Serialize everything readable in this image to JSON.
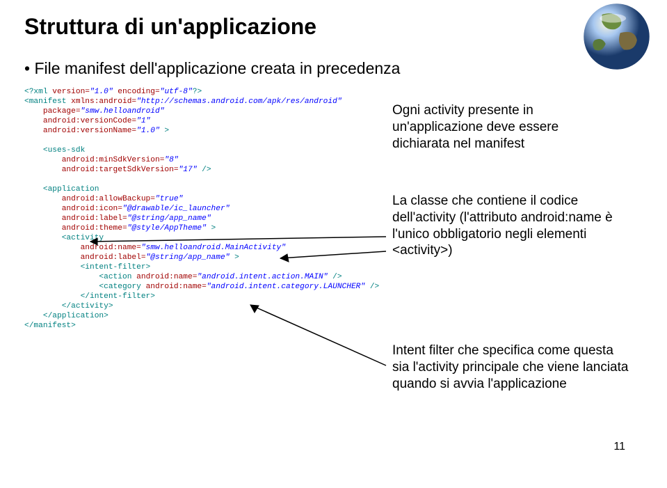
{
  "title": "Struttura di un'applicazione",
  "bullet1": "File manifest dell'applicazione creata in precedenza",
  "annotations": {
    "a1": "Ogni activity presente in un'applicazione deve essere dichiarata nel manifest",
    "a2": "La classe che contiene il codice dell'activity (l'attributo android:name è l'unico obbligatorio negli elementi <activity>)",
    "a3": "Intent filter che specifica come questa sia l'activity principale che viene lanciata quando si avvia l'applicazione"
  },
  "code": {
    "l1a": "<?xml ",
    "l1b": "version=",
    "l1c": "\"1.0\"",
    "l1d": " encoding=",
    "l1e": "\"utf-8\"",
    "l1f": "?>",
    "l2a": "<manifest ",
    "l2b": "xmlns:android=",
    "l2c": "\"http://schemas.android.com/apk/res/android\"",
    "l3a": "    package=",
    "l3b": "\"smw.helloandroid\"",
    "l4a": "    android:versionCode=",
    "l4b": "\"1\"",
    "l5a": "    android:versionName=",
    "l5b": "\"1.0\"",
    "l5c": " >",
    "l6": "",
    "l7a": "    <uses-sdk",
    "l8a": "        android:minSdkVersion=",
    "l8b": "\"8\"",
    "l9a": "        android:targetSdkVersion=",
    "l9b": "\"17\"",
    "l9c": " />",
    "l10": "",
    "l11a": "    <application",
    "l12a": "        android:allowBackup=",
    "l12b": "\"true\"",
    "l13a": "        android:icon=",
    "l13b": "\"@drawable/ic_launcher\"",
    "l14a": "        android:label=",
    "l14b": "\"@string/app_name\"",
    "l15a": "        android:theme=",
    "l15b": "\"@style/AppTheme\"",
    "l15c": " >",
    "l16a": "        <activity",
    "l17a": "            android:name=",
    "l17b": "\"smw.helloandroid.MainActivity\"",
    "l18a": "            android:label=",
    "l18b": "\"@string/app_name\"",
    "l18c": " >",
    "l19a": "            <intent-filter>",
    "l20a": "                <action ",
    "l20b": "android:name=",
    "l20c": "\"android.intent.action.MAIN\"",
    "l20d": " />",
    "l21a": "                <category ",
    "l21b": "android:name=",
    "l21c": "\"android.intent.category.LAUNCHER\"",
    "l21d": " />",
    "l22a": "            </intent-filter>",
    "l23a": "        </activity>",
    "l24a": "    </application>",
    "l25a": "</manifest>"
  },
  "page_number": "11"
}
